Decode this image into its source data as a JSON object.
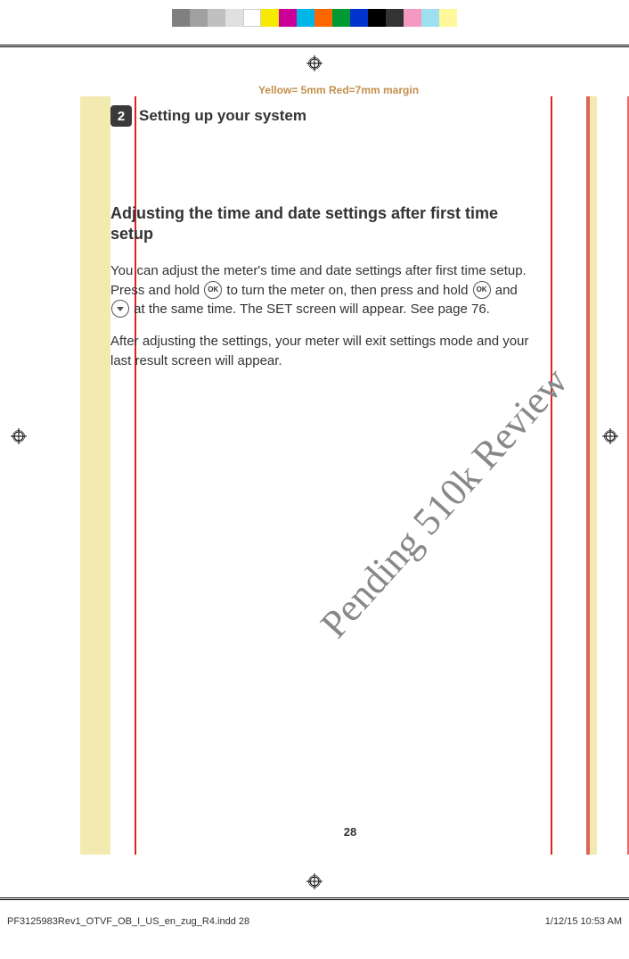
{
  "colorbar": [
    "#808080",
    "#a0a0a0",
    "#c0c0c0",
    "#e0e0e0",
    "#ffffff",
    "#f5ea00",
    "#cc0099",
    "#00b6e6",
    "#ff6600",
    "#009933",
    "#0033cc",
    "#000000",
    "#333333",
    "#f49ac1",
    "#9ee0f0",
    "#fff799"
  ],
  "margin_note": "Yellow= 5mm  Red=7mm margin",
  "section": {
    "number": "2",
    "title": "Setting up your system"
  },
  "subhead": "Adjusting the time and date settings after first time setup",
  "para1_a": "You can adjust the meter's time and date settings after first time setup. Press and hold ",
  "para1_b": " to turn the meter on, then press and hold ",
  "para1_c": " and ",
  "para1_d": " at the same time. The SET screen will appear. See page 76.",
  "para2": "After adjusting the settings, your meter will exit settings mode and your last result screen will appear.",
  "icons": {
    "ok": "OK",
    "down": "v"
  },
  "watermark": "Pending 510k Review",
  "page_number": "28",
  "slug_file": "PF3125983Rev1_OTVF_OB_I_US_en_zug_R4.indd   28",
  "slug_date": "1/12/15   10:53 AM"
}
